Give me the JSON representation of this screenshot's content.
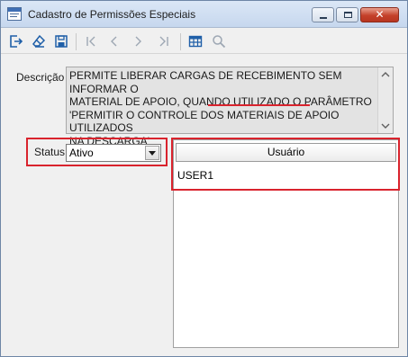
{
  "window": {
    "title": "Cadastro de Permissões Especiais",
    "close_glyph": "✕"
  },
  "toolbar": {
    "buttons": [
      "exit-icon",
      "eraser-icon",
      "save-icon",
      "first-record-icon",
      "previous-record-icon",
      "next-record-icon",
      "last-record-icon",
      "table-grid-icon",
      "search-icon"
    ]
  },
  "form": {
    "descricao_label": "Descrição",
    "descricao_value": "PERMITE LIBERAR CARGAS DE RECEBIMENTO SEM INFORMAR O\nMATERIAL DE APOIO, QUANDO UTILIZADO O PARÂMETRO\n'PERMITIR O CONTROLE DOS MATERIAIS DE APOIO UTILIZADOS\nNA DESCARGA'",
    "status_label": "Status",
    "status_value": "Ativo"
  },
  "grid": {
    "column_header": "Usuário",
    "rows": [
      "USER1"
    ]
  },
  "colors": {
    "highlight": "#d9232d",
    "title_bar": "#c6d7ee",
    "icon_blue": "#1f5fa8"
  }
}
